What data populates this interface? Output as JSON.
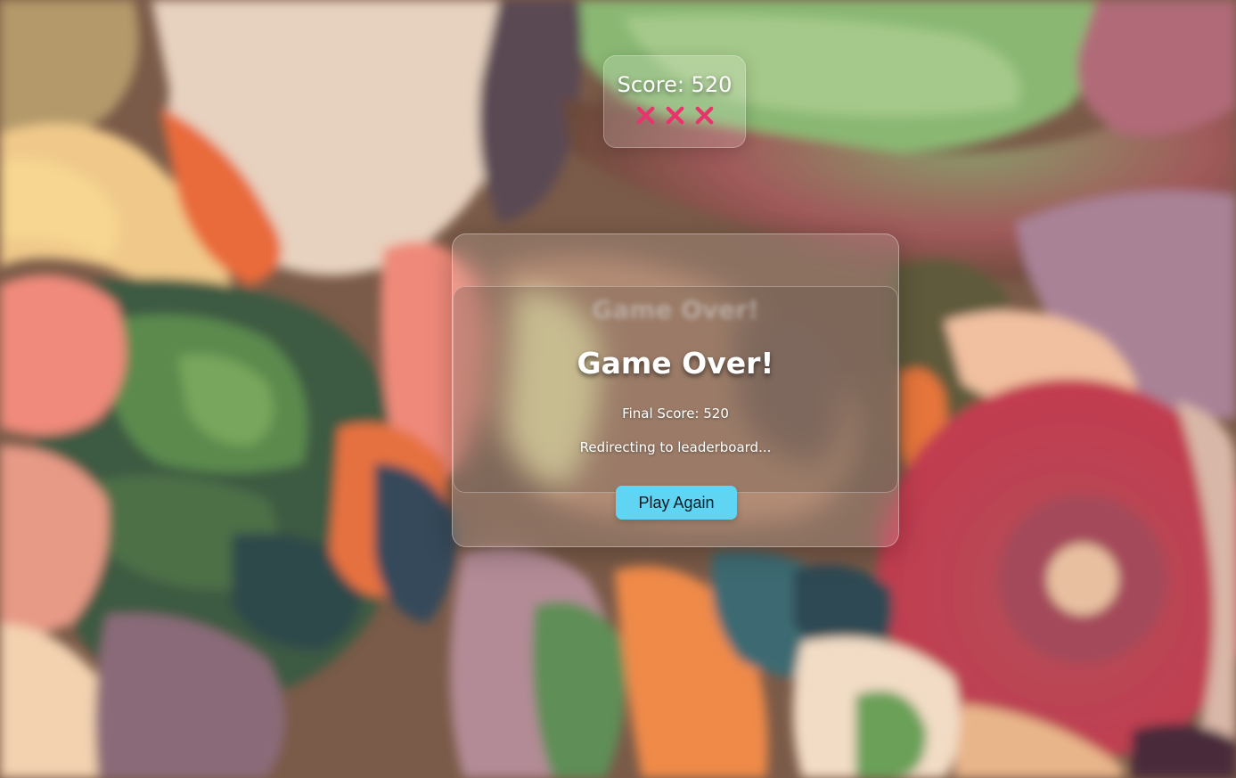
{
  "hud": {
    "score_text": "Score: 520",
    "lives_lost": 3,
    "life_icon": "x-mark-icon",
    "life_color": "#e8336d"
  },
  "game_over": {
    "ghost_title": "Game Over!",
    "title": "Game Over!",
    "final_score_text": "Final Score: 520",
    "redirect_text": "Redirecting to leaderboard...",
    "play_again_label": "Play Again",
    "button_color": "#5fd4f3"
  }
}
